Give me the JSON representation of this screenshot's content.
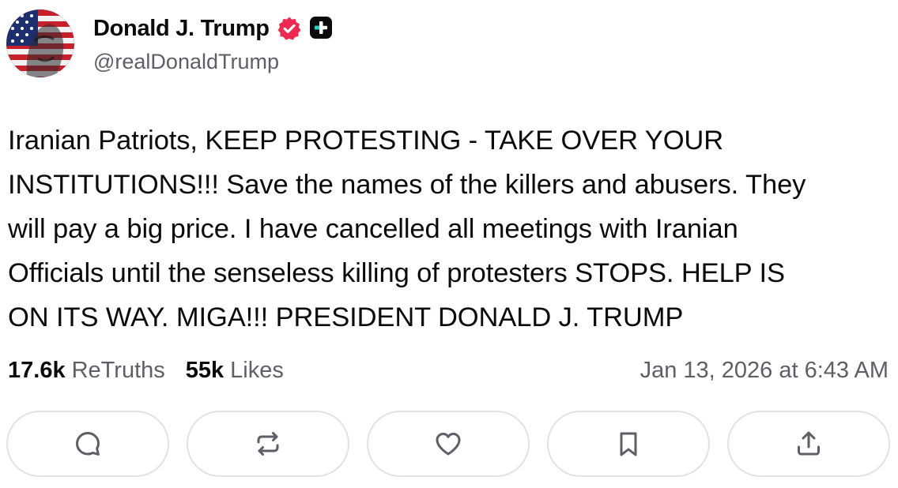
{
  "author": {
    "display_name": "Donald J. Trump",
    "handle": "@realDonaldTrump",
    "verified_icon": "verified-badge-icon",
    "extra_badge_icon": "plus-badge-icon",
    "avatar": "profile-photo-avatar"
  },
  "post": {
    "text_lines": [
      "Iranian Patriots, KEEP PROTESTING - TAKE OVER YOUR",
      "INSTITUTIONS!!! Save the names of the killers and abusers. They",
      "will pay a big price. I have cancelled all meetings with Iranian",
      "Officials until the senseless killing of protesters STOPS. HELP IS",
      "ON ITS WAY. MIGA!!! PRESIDENT DONALD J. TRUMP"
    ]
  },
  "stats": {
    "retruths_count": "17.6k",
    "retruths_label": "ReTruths",
    "likes_count": "55k",
    "likes_label": "Likes"
  },
  "timestamp": "Jan 13, 2026 at 6:43 AM",
  "actions": [
    {
      "name": "reply",
      "icon": "comment-icon"
    },
    {
      "name": "retruth",
      "icon": "repost-icon"
    },
    {
      "name": "like",
      "icon": "heart-icon"
    },
    {
      "name": "bookmark",
      "icon": "bookmark-icon"
    },
    {
      "name": "share",
      "icon": "share-icon"
    }
  ],
  "colors": {
    "text_primary": "#0b0b0d",
    "text_secondary": "#5e5e66",
    "verified_badge": "#f0284f",
    "button_border": "#e2e2e6",
    "icon_gray": "#5e5e66"
  }
}
